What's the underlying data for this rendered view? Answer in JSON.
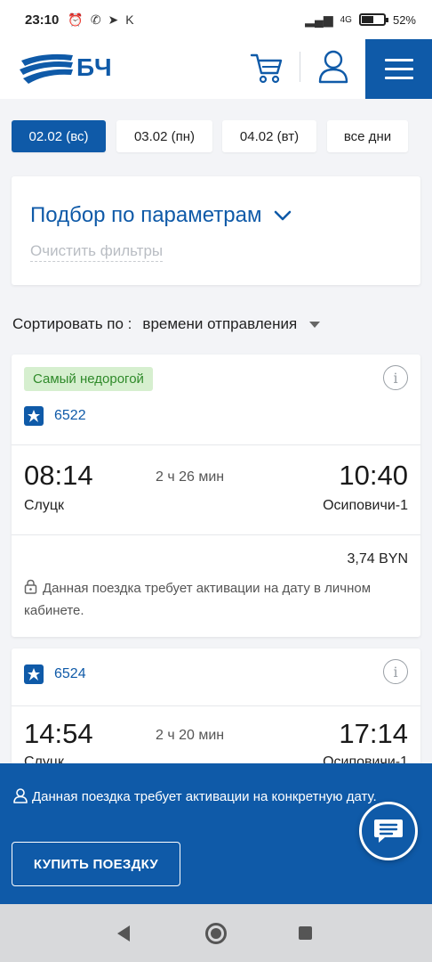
{
  "status_bar": {
    "time": "23:10",
    "battery": "52%",
    "network": "4G"
  },
  "header": {
    "logo_text": "БЧ",
    "icons": [
      "cart-icon",
      "user-icon",
      "menu-icon"
    ]
  },
  "date_tabs": [
    {
      "label": "02.02 (вс)",
      "active": true
    },
    {
      "label": "03.02 (пн)",
      "active": false
    },
    {
      "label": "04.02 (вт)",
      "active": false
    },
    {
      "label": "все дни",
      "active": false
    }
  ],
  "filter": {
    "title": "Подбор по параметрам",
    "clear_label": "Очистить фильтры"
  },
  "sort": {
    "label": "Сортировать по :",
    "value": "времени отправления"
  },
  "trips": [
    {
      "badge": "Самый недорогой",
      "train_number": "6522",
      "departure_time": "08:14",
      "arrival_time": "10:40",
      "duration": "2 ч 26 мин",
      "from": "Слуцк",
      "to": "Осиповичи-1",
      "price": "3,74 BYN",
      "note": "Данная поездка требует активации на дату в личном кабинете."
    },
    {
      "badge": "",
      "train_number": "6524",
      "departure_time": "14:54",
      "arrival_time": "17:14",
      "duration": "2 ч 20 мин",
      "from": "Слуцк",
      "to": "Осиповичи-1"
    }
  ],
  "bottom_panel": {
    "note": "Данная поездка требует активации на конкретную дату.",
    "buy_button": "КУПИТЬ ПОЕЗДКУ"
  },
  "colors": {
    "brand": "#0f5aa8",
    "badge_bg": "#d6efcf",
    "badge_text": "#2f8a2a"
  }
}
